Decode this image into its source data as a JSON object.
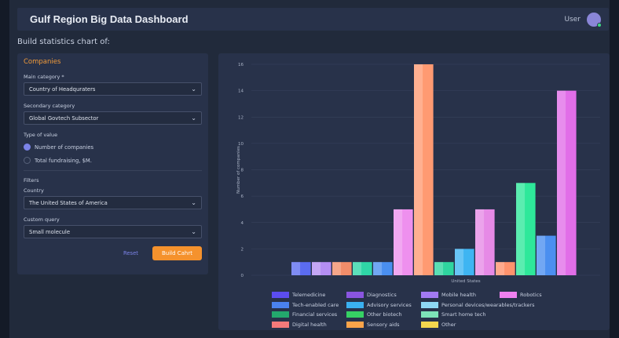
{
  "header": {
    "title": "Gulf Region Big Data Dashboard",
    "user_label": "User"
  },
  "subtitle": "Build statistics chart of:",
  "form": {
    "panel_title": "Companies",
    "main_category_label": "Main category *",
    "main_category_value": "Country of Headquraters",
    "secondary_category_label": "Secondary category",
    "secondary_category_value": "Global Govtech Subsector",
    "type_label": "Type of value",
    "type_options": [
      "Number of companies",
      "Total fundraising, $M."
    ],
    "type_selected": 0,
    "filters_label": "Filters",
    "country_label": "Country",
    "country_value": "The United States of America",
    "custom_query_label": "Custom query",
    "custom_query_value": "Small molecule",
    "reset_label": "Reset",
    "build_label": "Build Cahrt"
  },
  "icons": {
    "dropdown": "chevron-down-icon"
  },
  "colors": {
    "accent": "#f5922d",
    "link": "#7b83e8",
    "panel": "#28324a"
  },
  "chart_data": {
    "type": "bar",
    "ylabel": "Number of companies",
    "xlabel": "",
    "ylim": [
      0,
      16
    ],
    "yticks": [
      0,
      2,
      4,
      6,
      8,
      10,
      12,
      14,
      16
    ],
    "categories": [
      "United States"
    ],
    "series": [
      {
        "name": "Telemedicine",
        "value": 1,
        "color": "#5b6cf0"
      },
      {
        "name": "Diagnostics",
        "value": 1,
        "color": "#b48ef2"
      },
      {
        "name": "Mobile health",
        "value": 1,
        "color": "#f28d6a"
      },
      {
        "name": "Robotics",
        "value": 1,
        "color": "#2fd6a7"
      },
      {
        "name": "Tech-enabled care",
        "value": 1,
        "color": "#4a8ff0"
      },
      {
        "name": "Advisory services",
        "value": 5,
        "color": "#ee90ee"
      },
      {
        "name": "Personal devices/wearables/trackers",
        "value": 16,
        "color": "#ff9a72"
      },
      {
        "name": "Financial services",
        "value": 1,
        "color": "#2fd59f"
      },
      {
        "name": "Other biotech",
        "value": 2,
        "color": "#3eb5f2"
      },
      {
        "name": "Smart home tech",
        "value": 5,
        "color": "#e68ae6"
      },
      {
        "name": "Digital health",
        "value": 1,
        "color": "#ff936d"
      },
      {
        "name": "Sensory aids",
        "value": 7,
        "color": "#2ee89a"
      },
      {
        "name": "Other",
        "value": 3,
        "color": "#4b8ff0"
      },
      {
        "name": "",
        "value": 14,
        "color": "#e16ee8"
      }
    ],
    "legend": [
      [
        {
          "name": "Telemedicine",
          "color": "#5b4df0"
        },
        {
          "name": "Diagnostics",
          "color": "#8a55e0"
        },
        {
          "name": "Mobile health",
          "color": "#a27af2"
        },
        {
          "name": "Robotics",
          "color": "#ef80ef"
        }
      ],
      [
        {
          "name": "Tech-enabled care",
          "color": "#4a82f0"
        },
        {
          "name": "Advisory services",
          "color": "#3ab0f0"
        },
        {
          "name": "Personal devices/wearables/trackers",
          "color": "#8ed8f4"
        }
      ],
      [
        {
          "name": "Financial services",
          "color": "#23a86d"
        },
        {
          "name": "Other biotech",
          "color": "#36d164"
        },
        {
          "name": "Smart home tech",
          "color": "#7de3b8"
        }
      ],
      [
        {
          "name": "Digital health",
          "color": "#f47a7a"
        },
        {
          "name": "Sensory aids",
          "color": "#fba44a"
        },
        {
          "name": "Other",
          "color": "#f4d74e"
        }
      ]
    ]
  }
}
